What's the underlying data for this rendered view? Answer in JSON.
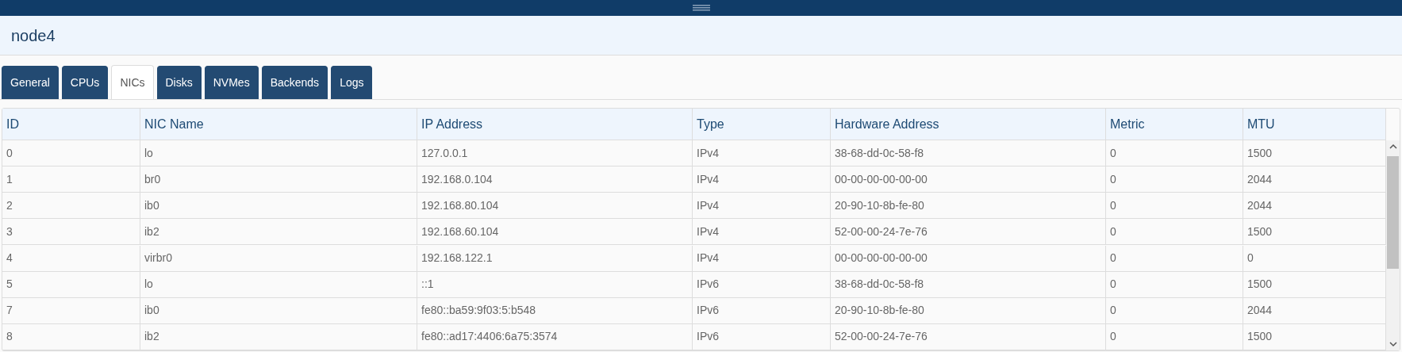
{
  "header": {
    "title": "node4"
  },
  "tabs": [
    {
      "label": "General",
      "selected": false
    },
    {
      "label": "CPUs",
      "selected": false
    },
    {
      "label": "NICs",
      "selected": true
    },
    {
      "label": "Disks",
      "selected": false
    },
    {
      "label": "NVMes",
      "selected": false
    },
    {
      "label": "Backends",
      "selected": false
    },
    {
      "label": "Logs",
      "selected": false
    }
  ],
  "table": {
    "columns": [
      "ID",
      "NIC Name",
      "IP Address",
      "Type",
      "Hardware Address",
      "Metric",
      "MTU"
    ],
    "rows": [
      [
        "0",
        "lo",
        "127.0.0.1",
        "IPv4",
        "38-68-dd-0c-58-f8",
        "0",
        "1500"
      ],
      [
        "1",
        "br0",
        "192.168.0.104",
        "IPv4",
        "00-00-00-00-00-00",
        "0",
        "2044"
      ],
      [
        "2",
        "ib0",
        "192.168.80.104",
        "IPv4",
        "20-90-10-8b-fe-80",
        "0",
        "2044"
      ],
      [
        "3",
        "ib2",
        "192.168.60.104",
        "IPv4",
        "52-00-00-24-7e-76",
        "0",
        "1500"
      ],
      [
        "4",
        "virbr0",
        "192.168.122.1",
        "IPv4",
        "00-00-00-00-00-00",
        "0",
        "0"
      ],
      [
        "5",
        "lo",
        "::1",
        "IPv6",
        "38-68-dd-0c-58-f8",
        "0",
        "1500"
      ],
      [
        "7",
        "ib0",
        "fe80::ba59:9f03:5:b548",
        "IPv6",
        "20-90-10-8b-fe-80",
        "0",
        "2044"
      ],
      [
        "8",
        "ib2",
        "fe80::ad17:4406:6a75:3574",
        "IPv6",
        "52-00-00-24-7e-76",
        "0",
        "1500"
      ]
    ]
  }
}
